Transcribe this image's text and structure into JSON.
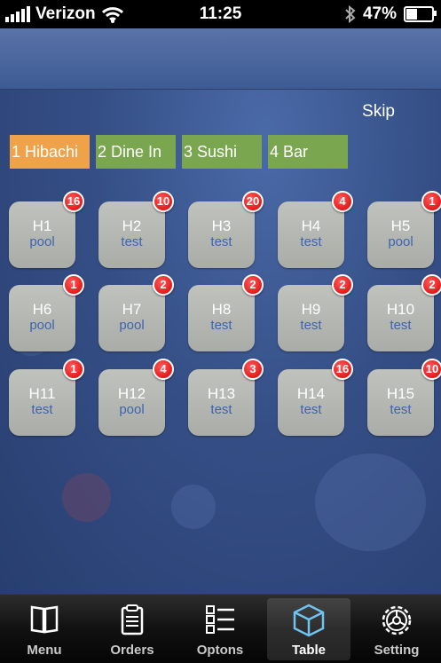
{
  "status": {
    "carrier": "Verizon",
    "time": "11:25",
    "battery": "47%",
    "battery_level": 0.47
  },
  "main": {
    "skip_label": "Skip",
    "categories": [
      {
        "label": "1 Hibachi",
        "active": true
      },
      {
        "label": "2 Dine In",
        "active": false
      },
      {
        "label": "3 Sushi",
        "active": false
      },
      {
        "label": "4 Bar",
        "active": false
      }
    ],
    "tables": [
      {
        "name": "H1",
        "sub": "pool",
        "badge": "16"
      },
      {
        "name": "H2",
        "sub": "test",
        "badge": "10"
      },
      {
        "name": "H3",
        "sub": "test",
        "badge": "20"
      },
      {
        "name": "H4",
        "sub": "test",
        "badge": "4"
      },
      {
        "name": "H5",
        "sub": "pool",
        "badge": "1"
      },
      {
        "name": "H6",
        "sub": "pool",
        "badge": "1"
      },
      {
        "name": "H7",
        "sub": "pool",
        "badge": "2"
      },
      {
        "name": "H8",
        "sub": "test",
        "badge": "2"
      },
      {
        "name": "H9",
        "sub": "test",
        "badge": "2"
      },
      {
        "name": "H10",
        "sub": "test",
        "badge": "2"
      },
      {
        "name": "H11",
        "sub": "test",
        "badge": "1"
      },
      {
        "name": "H12",
        "sub": "pool",
        "badge": "4"
      },
      {
        "name": "H13",
        "sub": "test",
        "badge": "3"
      },
      {
        "name": "H14",
        "sub": "test",
        "badge": "16"
      },
      {
        "name": "H15",
        "sub": "test",
        "badge": "10"
      }
    ]
  },
  "tabbar": {
    "items": [
      {
        "label": "Menu",
        "icon": "book-icon"
      },
      {
        "label": "Orders",
        "icon": "clipboard-icon"
      },
      {
        "label": "Optons",
        "icon": "list-icon"
      },
      {
        "label": "Table",
        "icon": "cube-icon",
        "active": true
      },
      {
        "label": "Setting",
        "icon": "gear-icon"
      }
    ]
  },
  "colors": {
    "hibachi_tab": "#f0a24a",
    "inactive_tab": "#7aa650",
    "badge": "#d80000",
    "tile_sub_text": "#3e64b0"
  }
}
